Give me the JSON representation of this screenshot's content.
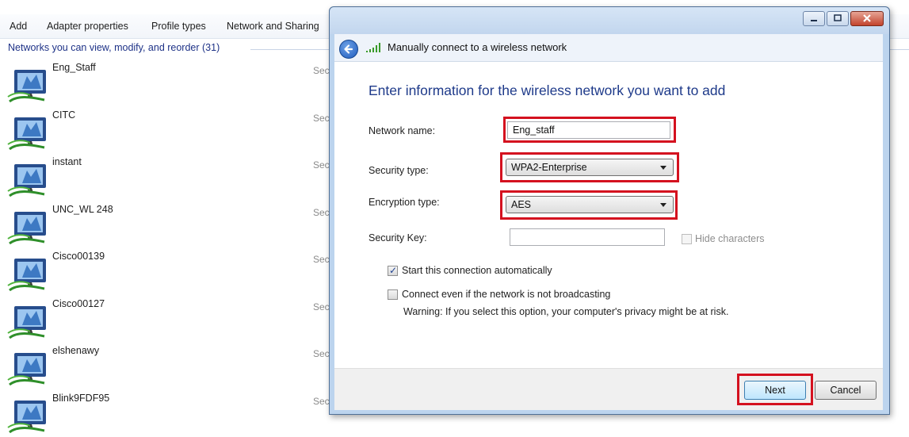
{
  "toolbar": {
    "add": "Add",
    "adapter_properties": "Adapter properties",
    "profile_types": "Profile types",
    "network_sharing": "Network and Sharing"
  },
  "networks": {
    "group_header": "Networks you can view, modify, and reorder (31)",
    "items": [
      {
        "name": "Eng_Staff",
        "security": "Sec"
      },
      {
        "name": "CITC",
        "security": "Sec"
      },
      {
        "name": "instant",
        "security": "Sec"
      },
      {
        "name": "UNC_WL 248",
        "security": "Sec"
      },
      {
        "name": "Cisco00139",
        "security": "Sec"
      },
      {
        "name": "Cisco00127",
        "security": "Sec"
      },
      {
        "name": "elshenawy",
        "security": "Sec"
      },
      {
        "name": "Blink9FDF95",
        "security": "Sec"
      }
    ]
  },
  "dialog": {
    "title": "Manually connect to a wireless network",
    "heading": "Enter information for the wireless network you want to add",
    "network_name_label": "Network name:",
    "network_name_value": "Eng_staff",
    "security_type_label": "Security type:",
    "security_type_value": "WPA2-Enterprise",
    "encryption_type_label": "Encryption type:",
    "encryption_type_value": "AES",
    "security_key_label": "Security Key:",
    "security_key_value": "",
    "hide_characters_label": "Hide characters",
    "auto_start_label": "Start this connection automatically",
    "auto_start_checked": true,
    "connect_hidden_label": "Connect even if the network is not broadcasting",
    "connect_hidden_checked": false,
    "warning_text": "Warning: If you select this option, your computer's privacy might be at risk.",
    "next_button": "Next",
    "cancel_button": "Cancel"
  },
  "colors": {
    "highlight": "#d4111f",
    "heading": "#1e3a8a"
  }
}
